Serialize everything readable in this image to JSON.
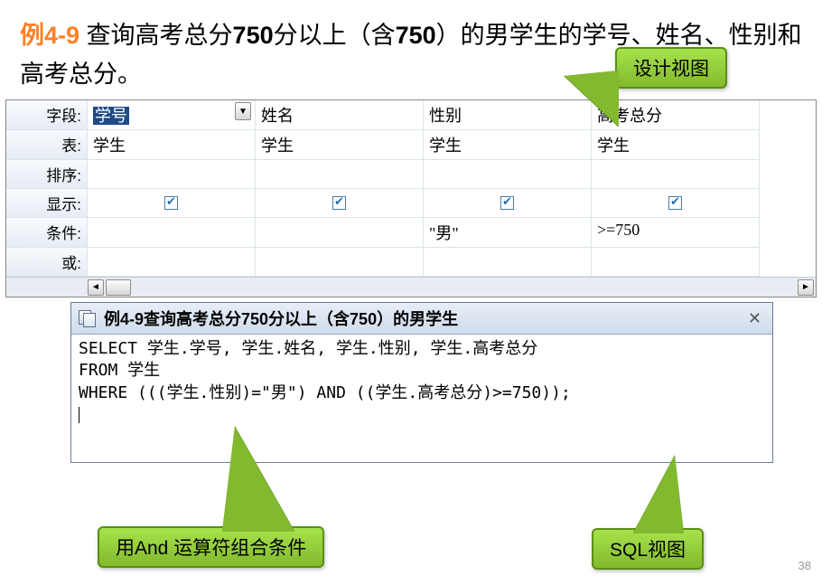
{
  "heading": {
    "example_label": "例",
    "example_number": "4-9",
    "text_before_bold1": "  查询高考总分",
    "bold1": "750",
    "text_mid1": "分以上（含",
    "bold2": "750",
    "text_after": "）的男学生的学号、姓名、性别和高考总分。"
  },
  "callouts": {
    "design_view": "设计视图",
    "and_label": "用And 运算符组合条件",
    "sql_view": "SQL视图"
  },
  "design_grid": {
    "row_labels": [
      "字段:",
      "表:",
      "排序:",
      "显示:",
      "条件:",
      "或:"
    ],
    "columns": [
      {
        "field": "学号",
        "table": "学生",
        "show": true,
        "criteria": "",
        "or": ""
      },
      {
        "field": "姓名",
        "table": "学生",
        "show": true,
        "criteria": "",
        "or": ""
      },
      {
        "field": "性别",
        "table": "学生",
        "show": true,
        "criteria": "\"男\"",
        "or": ""
      },
      {
        "field": "高考总分",
        "table": "学生",
        "show": true,
        "criteria": ">=750",
        "or": ""
      }
    ]
  },
  "sql_window": {
    "title": "例4-9查询高考总分750分以上（含750）的男学生",
    "line1": "SELECT 学生.学号, 学生.姓名, 学生.性别, 学生.高考总分",
    "line2": "FROM 学生",
    "line3": "WHERE (((学生.性别)=\"男\") AND ((学生.高考总分)>=750));"
  },
  "page_number": "38"
}
